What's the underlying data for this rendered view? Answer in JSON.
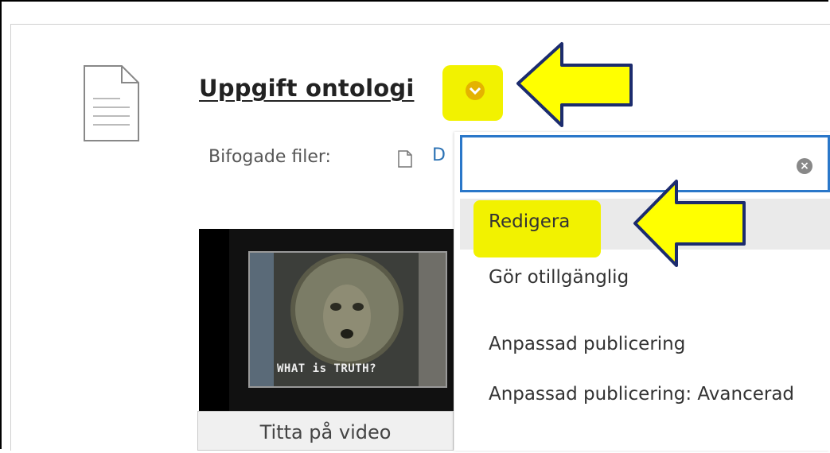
{
  "item": {
    "title": "Uppgift ontologi",
    "attachments_label": "Bifogade filer:",
    "attachment_link": "D"
  },
  "video": {
    "caption": "WHAT is TRUTH?",
    "button_label": "Titta på video"
  },
  "menu": {
    "items": [
      {
        "label": "Redigera"
      },
      {
        "label": "Gör otillgänglig"
      },
      {
        "label": "Anpassad publicering"
      },
      {
        "label": "Anpassad publicering: Avancerad"
      }
    ]
  },
  "colors": {
    "highlight": "#f2f200",
    "accent_blue": "#2a77c9",
    "chevron": "#e4b300"
  }
}
